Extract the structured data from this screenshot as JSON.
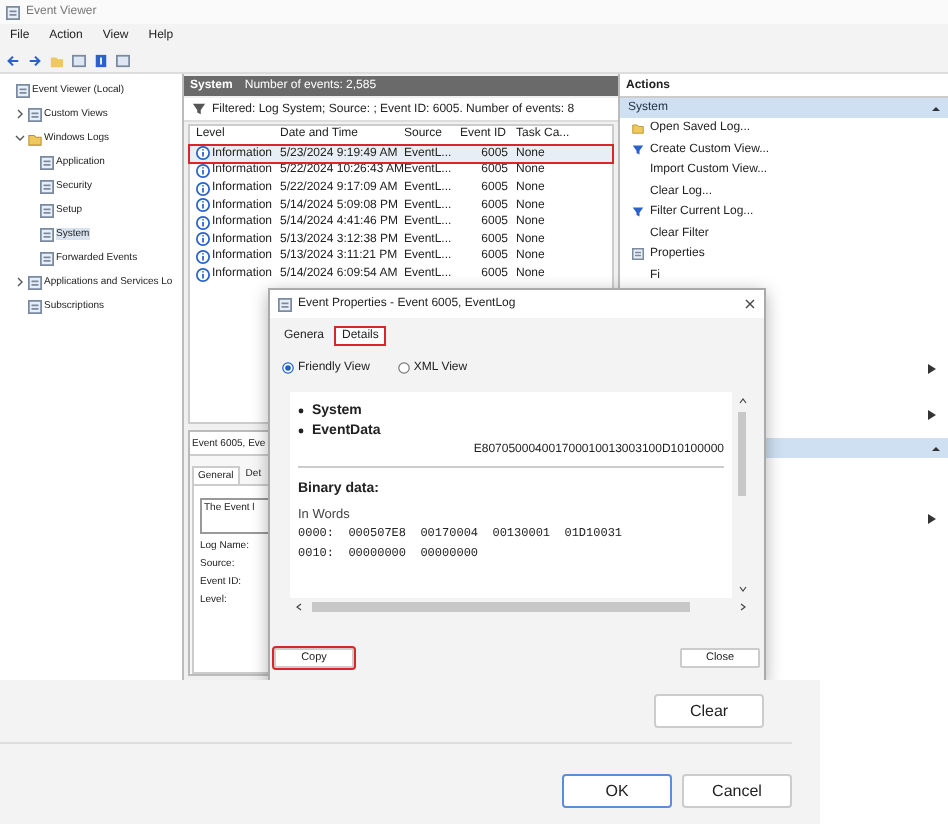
{
  "main_window": {
    "title": "Event Viewer",
    "menu": [
      "File",
      "Action",
      "View",
      "Help"
    ],
    "tree": [
      {
        "label": "Event Viewer (Local)",
        "selected": false,
        "children": [
          {
            "label": "Custom Views",
            "expanded": false,
            "selected": false
          },
          {
            "label": "Windows Logs",
            "expanded": true,
            "selected": false,
            "children": [
              {
                "label": "Application",
                "selected": false
              },
              {
                "label": "Security",
                "selected": false
              },
              {
                "label": "Setup",
                "selected": false
              },
              {
                "label": "System",
                "selected": true
              },
              {
                "label": "Forwarded Events",
                "selected": false
              }
            ]
          },
          {
            "label": "Applications and Services Lo",
            "expanded": false,
            "selected": false
          },
          {
            "label": "Subscriptions",
            "selected": false
          }
        ]
      }
    ],
    "log_header": {
      "name": "System",
      "count": "Number of events: 2,585"
    },
    "filter": "Filtered: Log System; Source: ; Event ID: 6005. Number of events: 8",
    "columns": [
      "Level",
      "Date and Time",
      "Source",
      "Event ID",
      "Task Ca..."
    ],
    "rows": [
      {
        "level": "Information",
        "date": "5/23/2024 9:19:49 AM",
        "source": "EventL...",
        "event_id": "6005",
        "task": "None",
        "selected": true,
        "highlighted": true
      },
      {
        "level": "Information",
        "date": "5/22/2024 10:26:43 AM",
        "source": "EventL...",
        "event_id": "6005",
        "task": "None",
        "selected": false,
        "highlighted": false
      },
      {
        "level": "Information",
        "date": "5/22/2024 9:17:09 AM",
        "source": "EventL...",
        "event_id": "6005",
        "task": "None",
        "selected": false,
        "highlighted": false
      },
      {
        "level": "Information",
        "date": "5/14/2024 5:09:08 PM",
        "source": "EventL...",
        "event_id": "6005",
        "task": "None",
        "selected": false,
        "highlighted": false
      },
      {
        "level": "Information",
        "date": "5/14/2024 4:41:46 PM",
        "source": "EventL...",
        "event_id": "6005",
        "task": "None",
        "selected": false,
        "highlighted": false
      },
      {
        "level": "Information",
        "date": "5/13/2024 3:12:38 PM",
        "source": "EventL...",
        "event_id": "6005",
        "task": "None",
        "selected": false,
        "highlighted": false
      },
      {
        "level": "Information",
        "date": "5/13/2024 3:11:21 PM",
        "source": "EventL...",
        "event_id": "6005",
        "task": "None",
        "selected": false,
        "highlighted": false
      },
      {
        "level": "Information",
        "date": "5/14/2024 6:09:54 AM",
        "source": "EventL...",
        "event_id": "6005",
        "task": "None",
        "selected": false,
        "highlighted": false
      }
    ],
    "preview": {
      "title": "Event 6005, Eve",
      "tabs": [
        {
          "label": "General",
          "selected": true
        },
        {
          "label": "Det",
          "selected": false
        }
      ],
      "message": "The Event l",
      "fields": [
        "Log Name:",
        "Source:",
        "Event ID:",
        "Level:"
      ]
    },
    "actions": {
      "title": "Actions",
      "section": "System",
      "items": [
        "Open Saved Log...",
        "Create Custom View...",
        "Import Custom View...",
        "Clear Log...",
        "Filter Current Log...",
        "Clear Filter",
        "Properties",
        "Fi"
      ]
    }
  },
  "properties_dialog": {
    "title": "Event Properties - Event 6005, EventLog",
    "tabs": [
      {
        "label": "Genera",
        "selected": false,
        "highlighted": false
      },
      {
        "label": "Details",
        "selected": true,
        "highlighted": true
      }
    ],
    "views": [
      {
        "label": "Friendly View",
        "selected": true
      },
      {
        "label": "XML View",
        "selected": false
      }
    ],
    "nodes": [
      "System",
      "EventData"
    ],
    "event_data": "E807050004001700010013003100D10100000",
    "binary_label": "Binary data:",
    "words_label": "In Words",
    "hex_lines": [
      "0000:  000507E8  00170004  00130001  01D10031",
      "0010:  00000000  00000000"
    ],
    "buttons": [
      {
        "label": "Copy",
        "highlighted": true
      },
      {
        "label": "Close",
        "highlighted": false
      }
    ]
  },
  "bottom_dialog": {
    "clear": "Clear",
    "buttons": [
      {
        "label": "OK",
        "default": true
      },
      {
        "label": "Cancel",
        "default": false
      }
    ]
  }
}
